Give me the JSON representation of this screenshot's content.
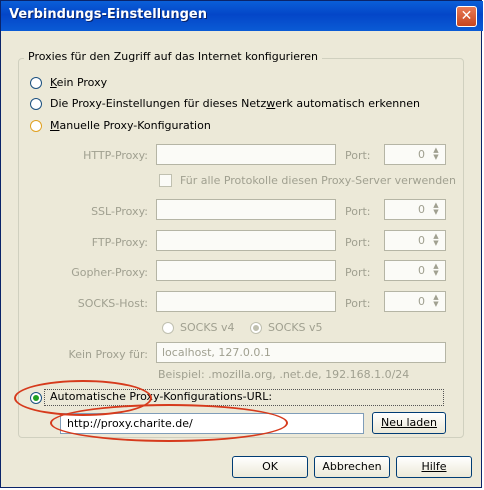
{
  "window": {
    "title": "Verbindungs-Einstellungen",
    "close_glyph": "✕"
  },
  "group": {
    "title": "Proxies für den Zugriff auf das Internet konfigurieren"
  },
  "options": {
    "no_proxy": {
      "pre": "",
      "key": "K",
      "post": "ein Proxy"
    },
    "auto_detect": {
      "pre": "Die Proxy-Einstellungen für dieses Netz",
      "key": "w",
      "post": "erk automatisch erkennen"
    },
    "manual": {
      "pre": "",
      "key": "M",
      "post": "anuelle Proxy-Konfiguration"
    },
    "auto_url": {
      "text": "Automatische Proxy-Konfigurations-URL:"
    }
  },
  "manual": {
    "http": {
      "label": "HTTP-Proxy:",
      "port_label": "Port:",
      "port": "0"
    },
    "all_protocols": "Für alle Protokolle diesen Proxy-Server verwenden",
    "ssl": {
      "label": "SSL-Proxy:",
      "port_label": "Port:",
      "port": "0"
    },
    "ftp": {
      "label": "FTP-Proxy:",
      "port_label": "Port:",
      "port": "0"
    },
    "gopher": {
      "label": "Gopher-Proxy:",
      "port_label": "Port:",
      "port": "0"
    },
    "socks": {
      "label": "SOCKS-Host:",
      "port_label": "Port:",
      "port": "0"
    },
    "socks_v4": "SOCKS v4",
    "socks_v5": "SOCKS v5",
    "no_proxy_for": {
      "label": "Kein Proxy für:",
      "value": "localhost, 127.0.0.1"
    },
    "example": "Beispiel: .mozilla.org, .net.de, 192.168.1.0/24"
  },
  "auto_config": {
    "url": "http://proxy.charite.de/",
    "reload": "Neu laden"
  },
  "buttons": {
    "ok": "OK",
    "cancel": "Abbrechen",
    "help": "Hilfe"
  },
  "state": {
    "selected_mode": "auto_url",
    "socks_version": "v5"
  },
  "colors": {
    "title_bar": "#0446c8",
    "annotation": "#d63a1c",
    "dialog_bg": "#ece9d8"
  }
}
